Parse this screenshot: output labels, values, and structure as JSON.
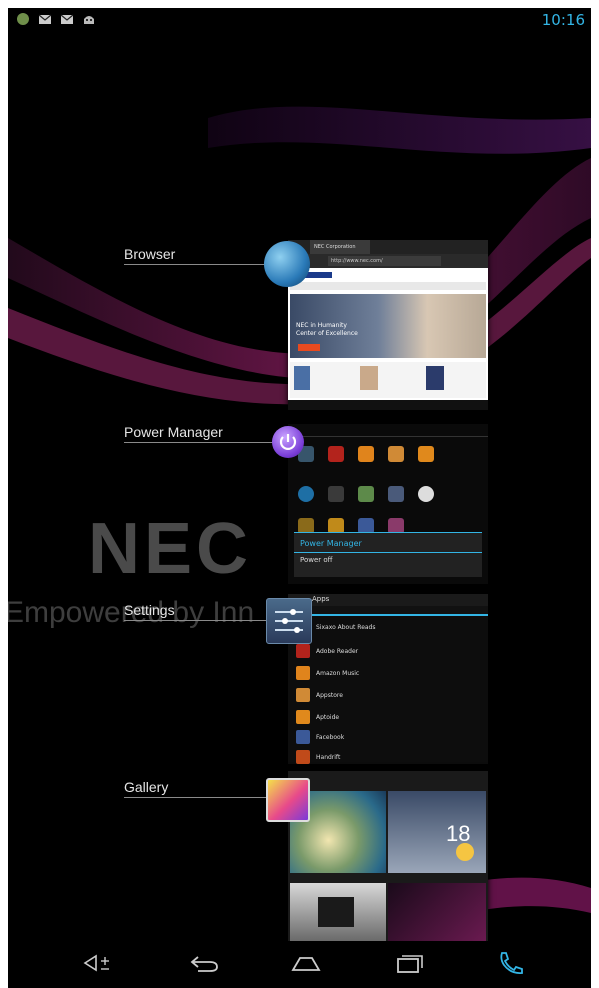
{
  "status_bar": {
    "icons": [
      "android-status-icon",
      "gmail-icon",
      "gmail-icon",
      "android-robot-icon"
    ],
    "time": "10:16"
  },
  "wallpaper": {
    "logo_text": "NEC",
    "tagline": "Empowered by Inn"
  },
  "recent_apps": [
    {
      "label": "Browser",
      "icon": "browser-globe-icon"
    },
    {
      "label": "Power Manager",
      "icon": "power-icon"
    },
    {
      "label": "Settings",
      "icon": "settings-sliders-icon"
    },
    {
      "label": "Gallery",
      "icon": "gallery-icon"
    }
  ],
  "browser_thumb": {
    "tab_title": "NEC Corporation",
    "url": "http://www.nec.com/",
    "hero_line1": "NEC in Humanity",
    "hero_line2": "Center of Excellence"
  },
  "power_manager_thumb": {
    "dialog_title": "Power Manager",
    "item1": "Power off"
  },
  "settings_thumb": {
    "header": "Apps",
    "apps": [
      {
        "name": "Sixaxo About Reads"
      },
      {
        "name": "Adobe Reader"
      },
      {
        "name": "Amazon Music"
      },
      {
        "name": "Appstore"
      },
      {
        "name": "Aptoide"
      },
      {
        "name": "Facebook"
      },
      {
        "name": "Handrift"
      }
    ]
  },
  "gallery_thumb": {
    "weather_temp": "18"
  },
  "nav_bar": {
    "buttons": [
      "volume-icon",
      "back-icon",
      "home-icon",
      "recent-apps-icon",
      "phone-icon"
    ]
  },
  "colors": {
    "accent": "#33b5e5",
    "background": "#000000"
  }
}
